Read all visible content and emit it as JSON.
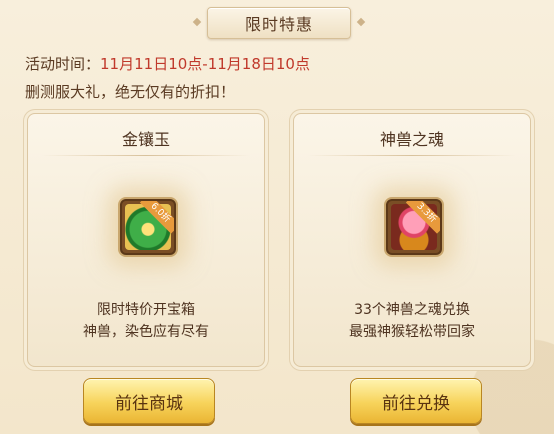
{
  "header": {
    "title": "限时特惠"
  },
  "info": {
    "time_label": "活动时间：",
    "time_range": "11月11日10点-11月18日10点",
    "slogan": "删测服大礼，绝无仅有的折扣！"
  },
  "offers": [
    {
      "name": "金镶玉",
      "icon": "jade-pendant-icon",
      "discount": "6.0折",
      "desc_line1": "限时特价开宝箱",
      "desc_line2": "神兽，染色应有尽有",
      "button": "前往商城"
    },
    {
      "name": "神兽之魂",
      "icon": "beast-soul-icon",
      "discount": "3.3折",
      "desc_line1": "33个神兽之魂兑换",
      "desc_line2": "最强神猴轻松带回家",
      "button": "前往兑换"
    }
  ],
  "colors": {
    "accent_red": "#c0392b",
    "button_gold": "#f7d35a"
  }
}
